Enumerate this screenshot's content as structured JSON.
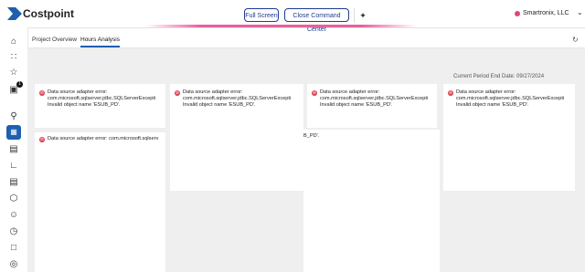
{
  "app": {
    "title": "Costpoint",
    "company": "Smartronix, LLC"
  },
  "toolbar": {
    "full_screen": "Full Screen",
    "close_command_center": "Close Command Center",
    "pin_icon": "pin-icon"
  },
  "colors": {
    "accent": "#1f5fb0",
    "pink": "#e7619f",
    "error": "#d8394a",
    "button_border": "#1f3a93"
  },
  "sidebar": {
    "items": [
      {
        "icon": "home-icon"
      },
      {
        "icon": "grid-icon"
      },
      {
        "icon": "star-icon"
      },
      {
        "icon": "image-icon",
        "badge": "1"
      },
      {
        "icon": "search-icon"
      },
      {
        "icon": "dashboard-icon",
        "active": true
      },
      {
        "icon": "document-icon"
      },
      {
        "icon": "chart-icon"
      },
      {
        "icon": "list-icon"
      },
      {
        "icon": "cube-icon"
      },
      {
        "icon": "people-icon"
      },
      {
        "icon": "clock-icon"
      },
      {
        "icon": "file-icon"
      },
      {
        "icon": "globe-icon"
      }
    ]
  },
  "tabs": [
    {
      "label": "Project Overview"
    },
    {
      "label": "Hours Analysis",
      "active": true
    }
  ],
  "period": {
    "label": "Current Period End Date:",
    "value": "09/27/2024"
  },
  "errors": {
    "line1": "Data source adapter error:",
    "line2": "com.microsoft.sqlserver.jdbc.SQLServerExcepti",
    "line3": "Invalid object name 'ESUB_PD'.",
    "wide": "Data source adapter error: com.microsoft.sqlserv",
    "partial": "B_PD'."
  }
}
